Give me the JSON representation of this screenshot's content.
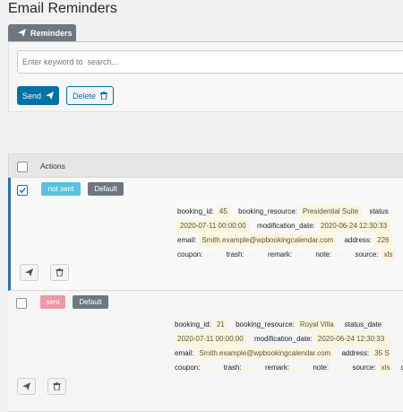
{
  "page": {
    "title": "Email Reminders"
  },
  "tabs": [
    {
      "label": "Reminders",
      "icon": "paper-plane-icon"
    }
  ],
  "toolbar": {
    "search_placeholder": "Enter keyword to  search...",
    "send_label": "Send",
    "delete_label": "Delete"
  },
  "list": {
    "header": {
      "actions_label": "Actions"
    },
    "rows": [
      {
        "checked": true,
        "status": "not sent",
        "status_color": "#5bc0de",
        "tag": "Default",
        "fields": {
          "booking_id_label": "booking_id:",
          "booking_id": "45",
          "booking_resource_label": "booking_resource:",
          "booking_resource": "Presidential Suite",
          "status_label": "status",
          "date": "2020-07-11 00:00:00",
          "modification_date_label": "modification_date:",
          "modification_date": "2020-06-24 12:30:33",
          "email_label": "email:",
          "email": "Smith.example@wpbookingcalendar.com",
          "address_label": "address:",
          "address": "226",
          "coupon_label": "coupon:",
          "trash_label": "trash:",
          "remark_label": "remark:",
          "note_label": "note:",
          "source_label": "source:",
          "source": "xls",
          "extra_label": "cre"
        }
      },
      {
        "checked": false,
        "status": "sent",
        "status_color": "#f096a6",
        "tag": "Default",
        "fields": {
          "booking_id_label": "booking_id:",
          "booking_id": "21",
          "booking_resource_label": "booking_resource:",
          "booking_resource": "Royal Villa",
          "status_label": "status_date",
          "date": "2020-07-11 00:00:00",
          "modification_date_label": "modification_date:",
          "modification_date": "2020-06-24 12:30:33",
          "email_label": "email:",
          "email": "Smith.example@wpbookingcalendar.com",
          "address_label": "address:",
          "address": "35 S",
          "coupon_label": "coupon:",
          "trash_label": "trash:",
          "remark_label": "remark:",
          "note_label": "note:",
          "source_label": "source:",
          "source": "xls",
          "extra_label": "crea"
        }
      }
    ]
  },
  "colors": {
    "primary": "#0071a1",
    "tab_bg": "#6e7680",
    "highlight": "#fcf5d8",
    "row_accent": "#2271b1"
  }
}
